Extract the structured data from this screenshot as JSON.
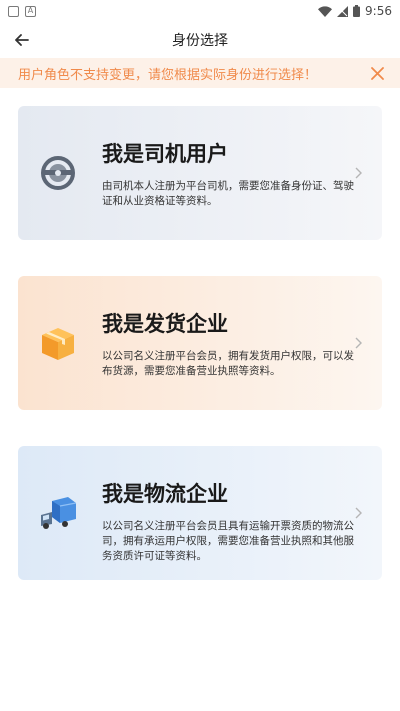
{
  "status_bar": {
    "time": "9:56",
    "indicator_left": "A"
  },
  "navbar": {
    "title": "身份选择"
  },
  "notice": {
    "text": "用户角色不支持变更，请您根据实际身份进行选择！"
  },
  "cards": [
    {
      "title": "我是司机用户",
      "description": "由司机本人注册为平台司机，需要您准备身份证、驾驶证和从业资格证等资料。",
      "icon": "steering-wheel-icon"
    },
    {
      "title": "我是发货企业",
      "description": "以公司名义注册平台会员，拥有发货用户权限，可以发布货源，需要您准备营业执照等资料。",
      "icon": "cargo-box-icon"
    },
    {
      "title": "我是物流企业",
      "description": "以公司名义注册平台会员且具有运输开票资质的物流公司，拥有承运用户权限，需要您准备营业执照和其他服务资质许可证等资料。",
      "icon": "truck-icon"
    }
  ],
  "colors": {
    "notice_text": "#f08a4b",
    "notice_bg": "#fdf1e8"
  }
}
